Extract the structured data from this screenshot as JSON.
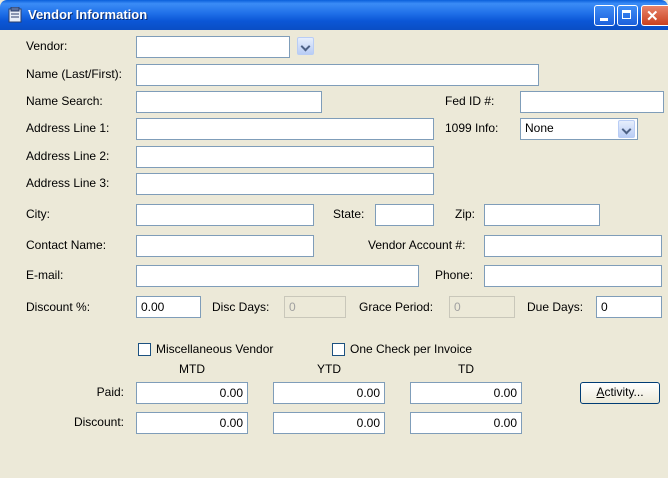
{
  "window": {
    "title": "Vendor Information"
  },
  "labels": {
    "vendor": "Vendor:",
    "name": "Name (Last/First):",
    "name_search": "Name Search:",
    "fed_id": "Fed ID #:",
    "address1": "Address Line 1:",
    "info_1099": "1099 Info:",
    "address2": "Address Line 2:",
    "address3": "Address Line 3:",
    "city": "City:",
    "state": "State:",
    "zip": "Zip:",
    "contact": "Contact Name:",
    "vendor_account": "Vendor Account #:",
    "email": "E-mail:",
    "phone": "Phone:",
    "discount_pct": "Discount %:",
    "disc_days": "Disc Days:",
    "grace_period": "Grace Period:",
    "due_days": "Due Days:",
    "misc_vendor": "Miscellaneous Vendor",
    "one_check": "One Check per Invoice",
    "mtd": "MTD",
    "ytd": "YTD",
    "td": "TD",
    "paid": "Paid:",
    "discount": "Discount:"
  },
  "values": {
    "vendor": "",
    "name": "",
    "name_search": "",
    "fed_id": "",
    "address1": "",
    "info_1099": "None",
    "address2": "",
    "address3": "",
    "city": "",
    "state": "",
    "zip": "",
    "contact": "",
    "vendor_account": "",
    "email": "",
    "phone": "",
    "discount_pct": "0.00",
    "disc_days": "0",
    "grace_period": "0",
    "due_days": "0",
    "paid_mtd": "0.00",
    "paid_ytd": "0.00",
    "paid_td": "0.00",
    "discount_mtd": "0.00",
    "discount_ytd": "0.00",
    "discount_td": "0.00"
  },
  "checkboxes": {
    "misc_vendor": false,
    "one_check": false
  },
  "buttons": {
    "activity_prefix": "A",
    "activity_rest": "ctivity..."
  },
  "icons": {
    "title": "document-icon",
    "minimize": "minimize-icon",
    "maximize": "maximize-icon",
    "close": "close-icon",
    "dropdown": "chevron-down-icon"
  }
}
